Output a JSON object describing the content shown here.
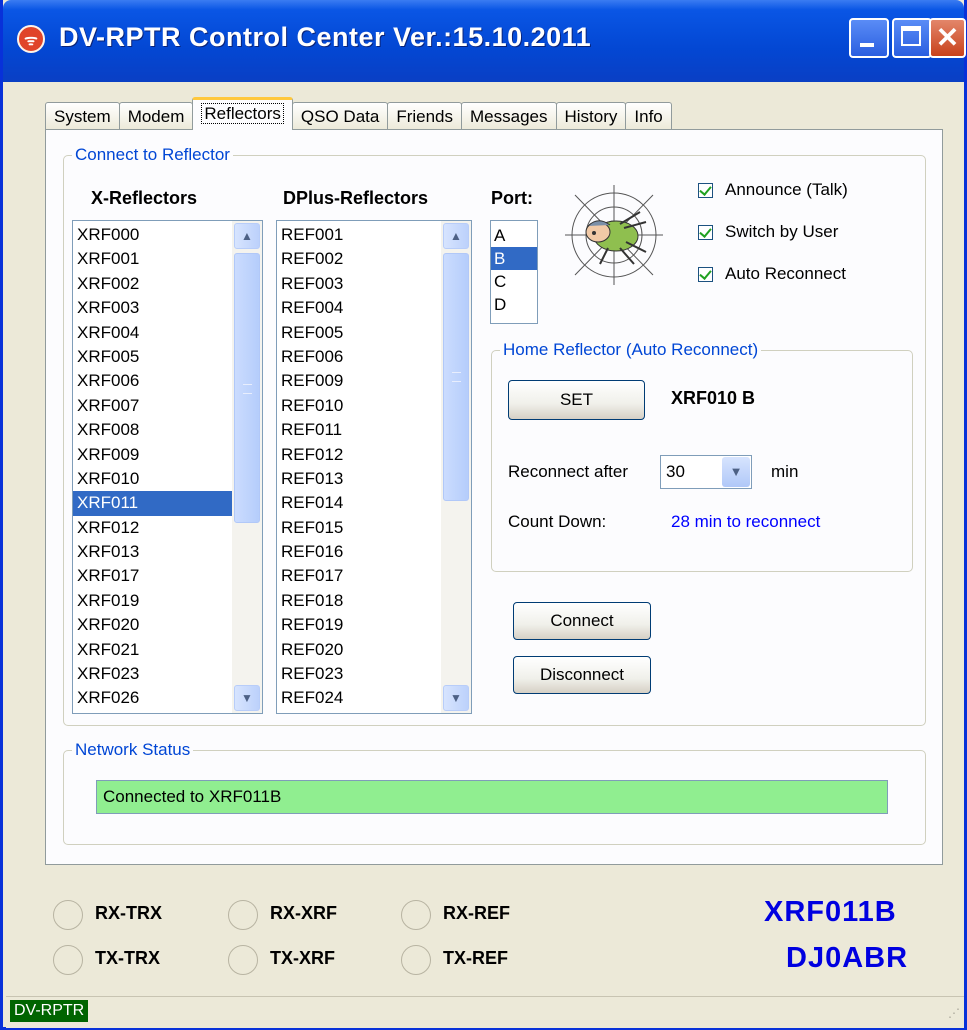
{
  "window": {
    "title": "DV-RPTR Control Center Ver.:15.10.2011",
    "app_icon": "rss-signal-icon",
    "controls": [
      "minimize-icon",
      "maximize-icon",
      "close-icon"
    ]
  },
  "tabs": [
    {
      "label": "System"
    },
    {
      "label": "Modem"
    },
    {
      "label": "Reflectors",
      "active": true
    },
    {
      "label": "QSO Data"
    },
    {
      "label": "Friends"
    },
    {
      "label": "Messages"
    },
    {
      "label": "History"
    },
    {
      "label": "Info"
    }
  ],
  "connect_group": {
    "title": "Connect to Reflector",
    "x_header": "X-Reflectors",
    "dplus_header": "DPlus-Reflectors",
    "port_header": "Port:",
    "x_reflectors": [
      "XRF000",
      "XRF001",
      "XRF002",
      "XRF003",
      "XRF004",
      "XRF005",
      "XRF006",
      "XRF007",
      "XRF008",
      "XRF009",
      "XRF010",
      "XRF011",
      "XRF012",
      "XRF013",
      "XRF017",
      "XRF019",
      "XRF020",
      "XRF021",
      "XRF023",
      "XRF026"
    ],
    "x_selected": "XRF011",
    "dplus_reflectors": [
      "REF001",
      "REF002",
      "REF003",
      "REF004",
      "REF005",
      "REF006",
      "REF009",
      "REF010",
      "REF011",
      "REF012",
      "REF013",
      "REF014",
      "REF015",
      "REF016",
      "REF017",
      "REF018",
      "REF019",
      "REF020",
      "REF023",
      "REF024"
    ],
    "ports": [
      "A",
      "B",
      "C",
      "D"
    ],
    "port_selected": "B",
    "checkboxes": [
      {
        "label": "Announce (Talk)",
        "checked": true
      },
      {
        "label": "Switch by User",
        "checked": true
      },
      {
        "label": "Auto Reconnect",
        "checked": true
      }
    ],
    "connect_label": "Connect",
    "disconnect_label": "Disconnect"
  },
  "home": {
    "title": "Home Reflector (Auto Reconnect)",
    "set_label": "SET",
    "home_value": "XRF010 B",
    "reconnect_label": "Reconnect after",
    "reconnect_value": "30",
    "unit": "min",
    "countdown_label": "Count Down:",
    "countdown_value": "28 min to reconnect",
    "countdown_color": "#0000ff"
  },
  "network": {
    "title": "Network Status",
    "status": "Connected to XRF011B",
    "status_color": "#90ee90"
  },
  "leds": {
    "rx_trx": "RX-TRX",
    "rx_xrf": "RX-XRF",
    "rx_ref": "RX-REF",
    "tx_trx": "TX-TRX",
    "tx_xrf": "TX-XRF",
    "tx_ref": "TX-REF"
  },
  "big_status": {
    "line1": "XRF011B",
    "line2": "DJ0ABR",
    "color": "#0000e0"
  },
  "statusbar": {
    "panel": "DV-RPTR",
    "panel_color": "#006400"
  }
}
